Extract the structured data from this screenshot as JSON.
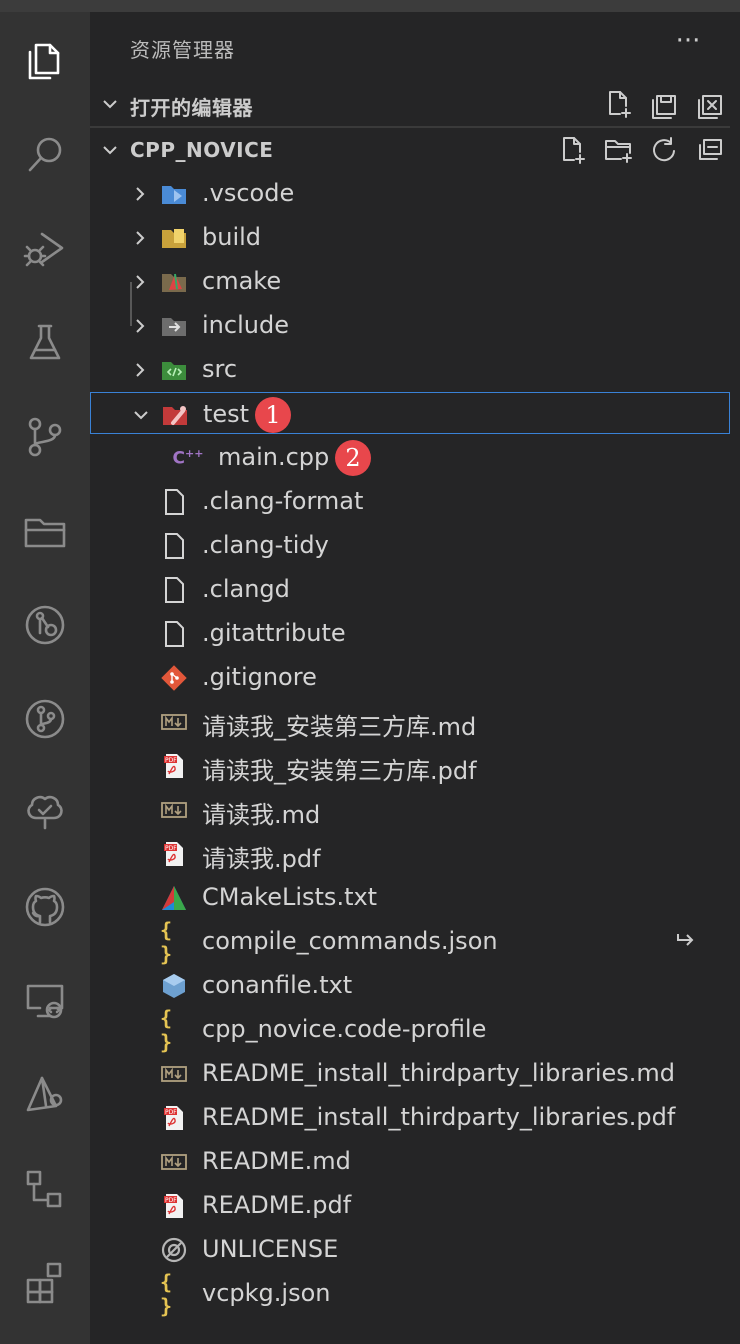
{
  "explorer": {
    "title": "资源管理器",
    "more": "···"
  },
  "sections": {
    "open_editors": "打开的编辑器",
    "project": "CPP_NOVICE"
  },
  "tree": [
    {
      "label": ".vscode",
      "icon": "folder-vscode-icon",
      "type": "folder",
      "expanded": false
    },
    {
      "label": "build",
      "icon": "folder-build-icon",
      "type": "folder",
      "expanded": false
    },
    {
      "label": "cmake",
      "icon": "folder-cmake-icon",
      "type": "folder",
      "expanded": false
    },
    {
      "label": "include",
      "icon": "folder-include-icon",
      "type": "folder",
      "expanded": false
    },
    {
      "label": "src",
      "icon": "folder-src-icon",
      "type": "folder",
      "expanded": false
    },
    {
      "label": "test",
      "icon": "folder-test-icon",
      "type": "folder",
      "expanded": true,
      "selected": true,
      "badge": "1"
    },
    {
      "label": "main.cpp",
      "icon": "cpp-icon",
      "type": "file",
      "nested": true,
      "badge": "2"
    },
    {
      "label": ".clang-format",
      "icon": "file-icon",
      "type": "file"
    },
    {
      "label": ".clang-tidy",
      "icon": "file-icon",
      "type": "file"
    },
    {
      "label": ".clangd",
      "icon": "file-icon",
      "type": "file"
    },
    {
      "label": ".gitattribute",
      "icon": "file-icon",
      "type": "file"
    },
    {
      "label": ".gitignore",
      "icon": "git-icon",
      "type": "file"
    },
    {
      "label": "请读我_安装第三方库.md",
      "icon": "markdown-icon",
      "type": "file"
    },
    {
      "label": "请读我_安装第三方库.pdf",
      "icon": "pdf-icon",
      "type": "file"
    },
    {
      "label": "请读我.md",
      "icon": "markdown-icon",
      "type": "file"
    },
    {
      "label": "请读我.pdf",
      "icon": "pdf-icon",
      "type": "file"
    },
    {
      "label": "CMakeLists.txt",
      "icon": "cmake-icon",
      "type": "file"
    },
    {
      "label": "compile_commands.json",
      "icon": "json-icon",
      "type": "file",
      "symlink": true
    },
    {
      "label": "conanfile.txt",
      "icon": "conan-icon",
      "type": "file"
    },
    {
      "label": "cpp_novice.code-profile",
      "icon": "json-icon",
      "type": "file"
    },
    {
      "label": "README_install_thirdparty_libraries.md",
      "icon": "markdown-icon",
      "type": "file"
    },
    {
      "label": "README_install_thirdparty_libraries.pdf",
      "icon": "pdf-icon",
      "type": "file"
    },
    {
      "label": "README.md",
      "icon": "markdown-icon",
      "type": "file"
    },
    {
      "label": "README.pdf",
      "icon": "pdf-icon",
      "type": "file"
    },
    {
      "label": "UNLICENSE",
      "icon": "license-icon",
      "type": "file"
    },
    {
      "label": "vcpkg.json",
      "icon": "json-icon",
      "type": "file"
    }
  ],
  "colors": {
    "selection_border": "#3a82d6",
    "badge": "#e8474c",
    "background": "#252526",
    "activity_bar": "#333333"
  }
}
